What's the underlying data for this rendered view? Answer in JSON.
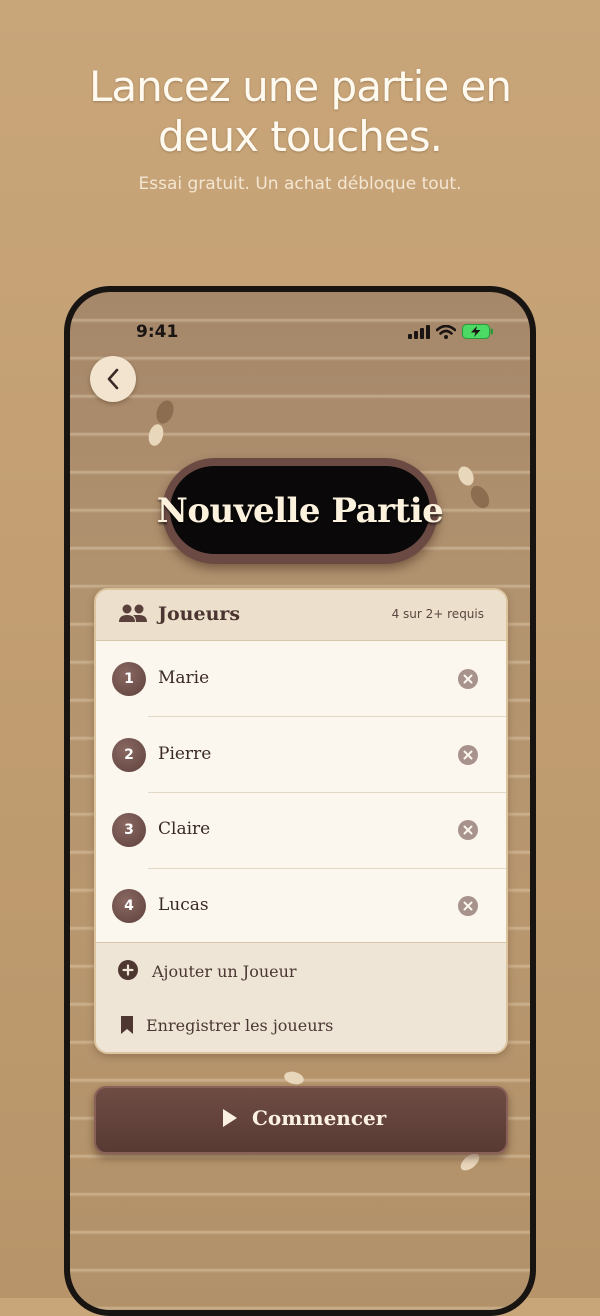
{
  "headline": {
    "line1": "Lancez une partie en",
    "line2": "deux touches.",
    "subtitle": "Essai gratuit. Un achat débloque tout."
  },
  "status_bar": {
    "time": "9:41",
    "icons": [
      "signal-icon",
      "wifi-icon",
      "battery-charging-icon"
    ]
  },
  "screen": {
    "back_icon": "chevron-left-icon",
    "title": "Nouvelle Partie"
  },
  "players_card": {
    "header_icon": "people-icon",
    "header_title": "Joueurs",
    "count_text": "4 sur 2+ requis",
    "players": [
      {
        "number": "1",
        "name": "Marie"
      },
      {
        "number": "2",
        "name": "Pierre"
      },
      {
        "number": "3",
        "name": "Claire"
      },
      {
        "number": "4",
        "name": "Lucas"
      }
    ],
    "remove_icon": "close-circle-icon",
    "add_label": "Ajouter un Joueur",
    "add_icon": "plus-circle-icon",
    "save_label": "Enregistrer les joueurs",
    "save_icon": "bookmark-icon"
  },
  "start_button": {
    "label": "Commencer",
    "icon": "play-icon"
  },
  "colors": {
    "background": "#c9a57a",
    "accent_brown": "#5e413c",
    "card_bg": "#fbf6ee",
    "battery_green": "#4cd964"
  }
}
